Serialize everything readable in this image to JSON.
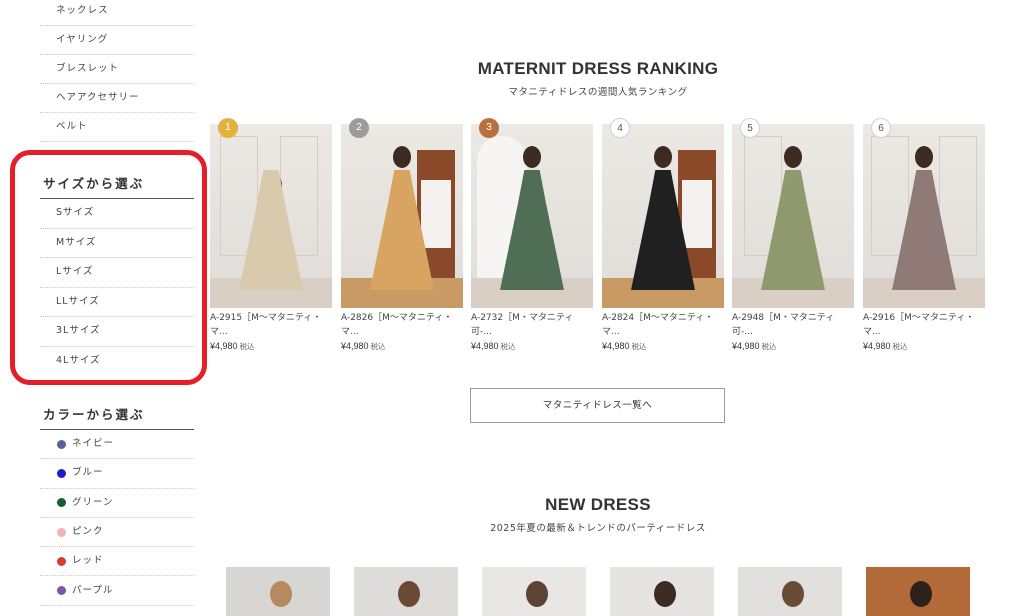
{
  "sidebar": {
    "categories": [
      "ネックレス",
      "イヤリング",
      "ブレスレット",
      "ヘアアクセサリー",
      "ベルト"
    ],
    "size_title": "サイズから選ぶ",
    "sizes": [
      "Sサイズ",
      "Mサイズ",
      "Lサイズ",
      "LLサイズ",
      "3Lサイズ",
      "4Lサイズ"
    ],
    "color_title": "カラーから選ぶ",
    "colors": [
      {
        "label": "ネイビー",
        "hex": "#5a5f9e"
      },
      {
        "label": "ブルー",
        "hex": "#1e1ec8"
      },
      {
        "label": "グリーン",
        "hex": "#15602f"
      },
      {
        "label": "ピンク",
        "hex": "#f3b0b8"
      },
      {
        "label": "レッド",
        "hex": "#d73a2e"
      },
      {
        "label": "パープル",
        "hex": "#7a55a8"
      }
    ]
  },
  "ranking": {
    "title": "MATERNIT DRESS RANKING",
    "subtitle": "マタニティドレスの週間人気ランキング",
    "products": [
      {
        "rank": "1",
        "name": "A-2915［M〜マタニティ・マ...",
        "price": "¥4,980",
        "tax": "税込",
        "dress_color": "#d9c9ad"
      },
      {
        "rank": "2",
        "name": "A-2826［M〜マタニティ・マ...",
        "price": "¥4,980",
        "tax": "税込",
        "dress_color": "#d7a561"
      },
      {
        "rank": "3",
        "name": "A-2732［M・マタニティ可-...",
        "price": "¥4,980",
        "tax": "税込",
        "dress_color": "#4f6e55"
      },
      {
        "rank": "4",
        "name": "A-2824［M〜マタニティ・マ...",
        "price": "¥4,980",
        "tax": "税込",
        "dress_color": "#202020"
      },
      {
        "rank": "5",
        "name": "A-2948［M・マタニティ可-...",
        "price": "¥4,980",
        "tax": "税込",
        "dress_color": "#8e9a6e"
      },
      {
        "rank": "6",
        "name": "A-2916［M〜マタニティ・マ...",
        "price": "¥4,980",
        "tax": "税込",
        "dress_color": "#8f7a78"
      }
    ],
    "list_button": "マタニティドレス一覧へ"
  },
  "new_dress": {
    "title": "NEW DRESS",
    "subtitle": "2025年夏の最新＆トレンドのパーティードレス"
  },
  "colors": {
    "highlight": "#e41e2b"
  }
}
